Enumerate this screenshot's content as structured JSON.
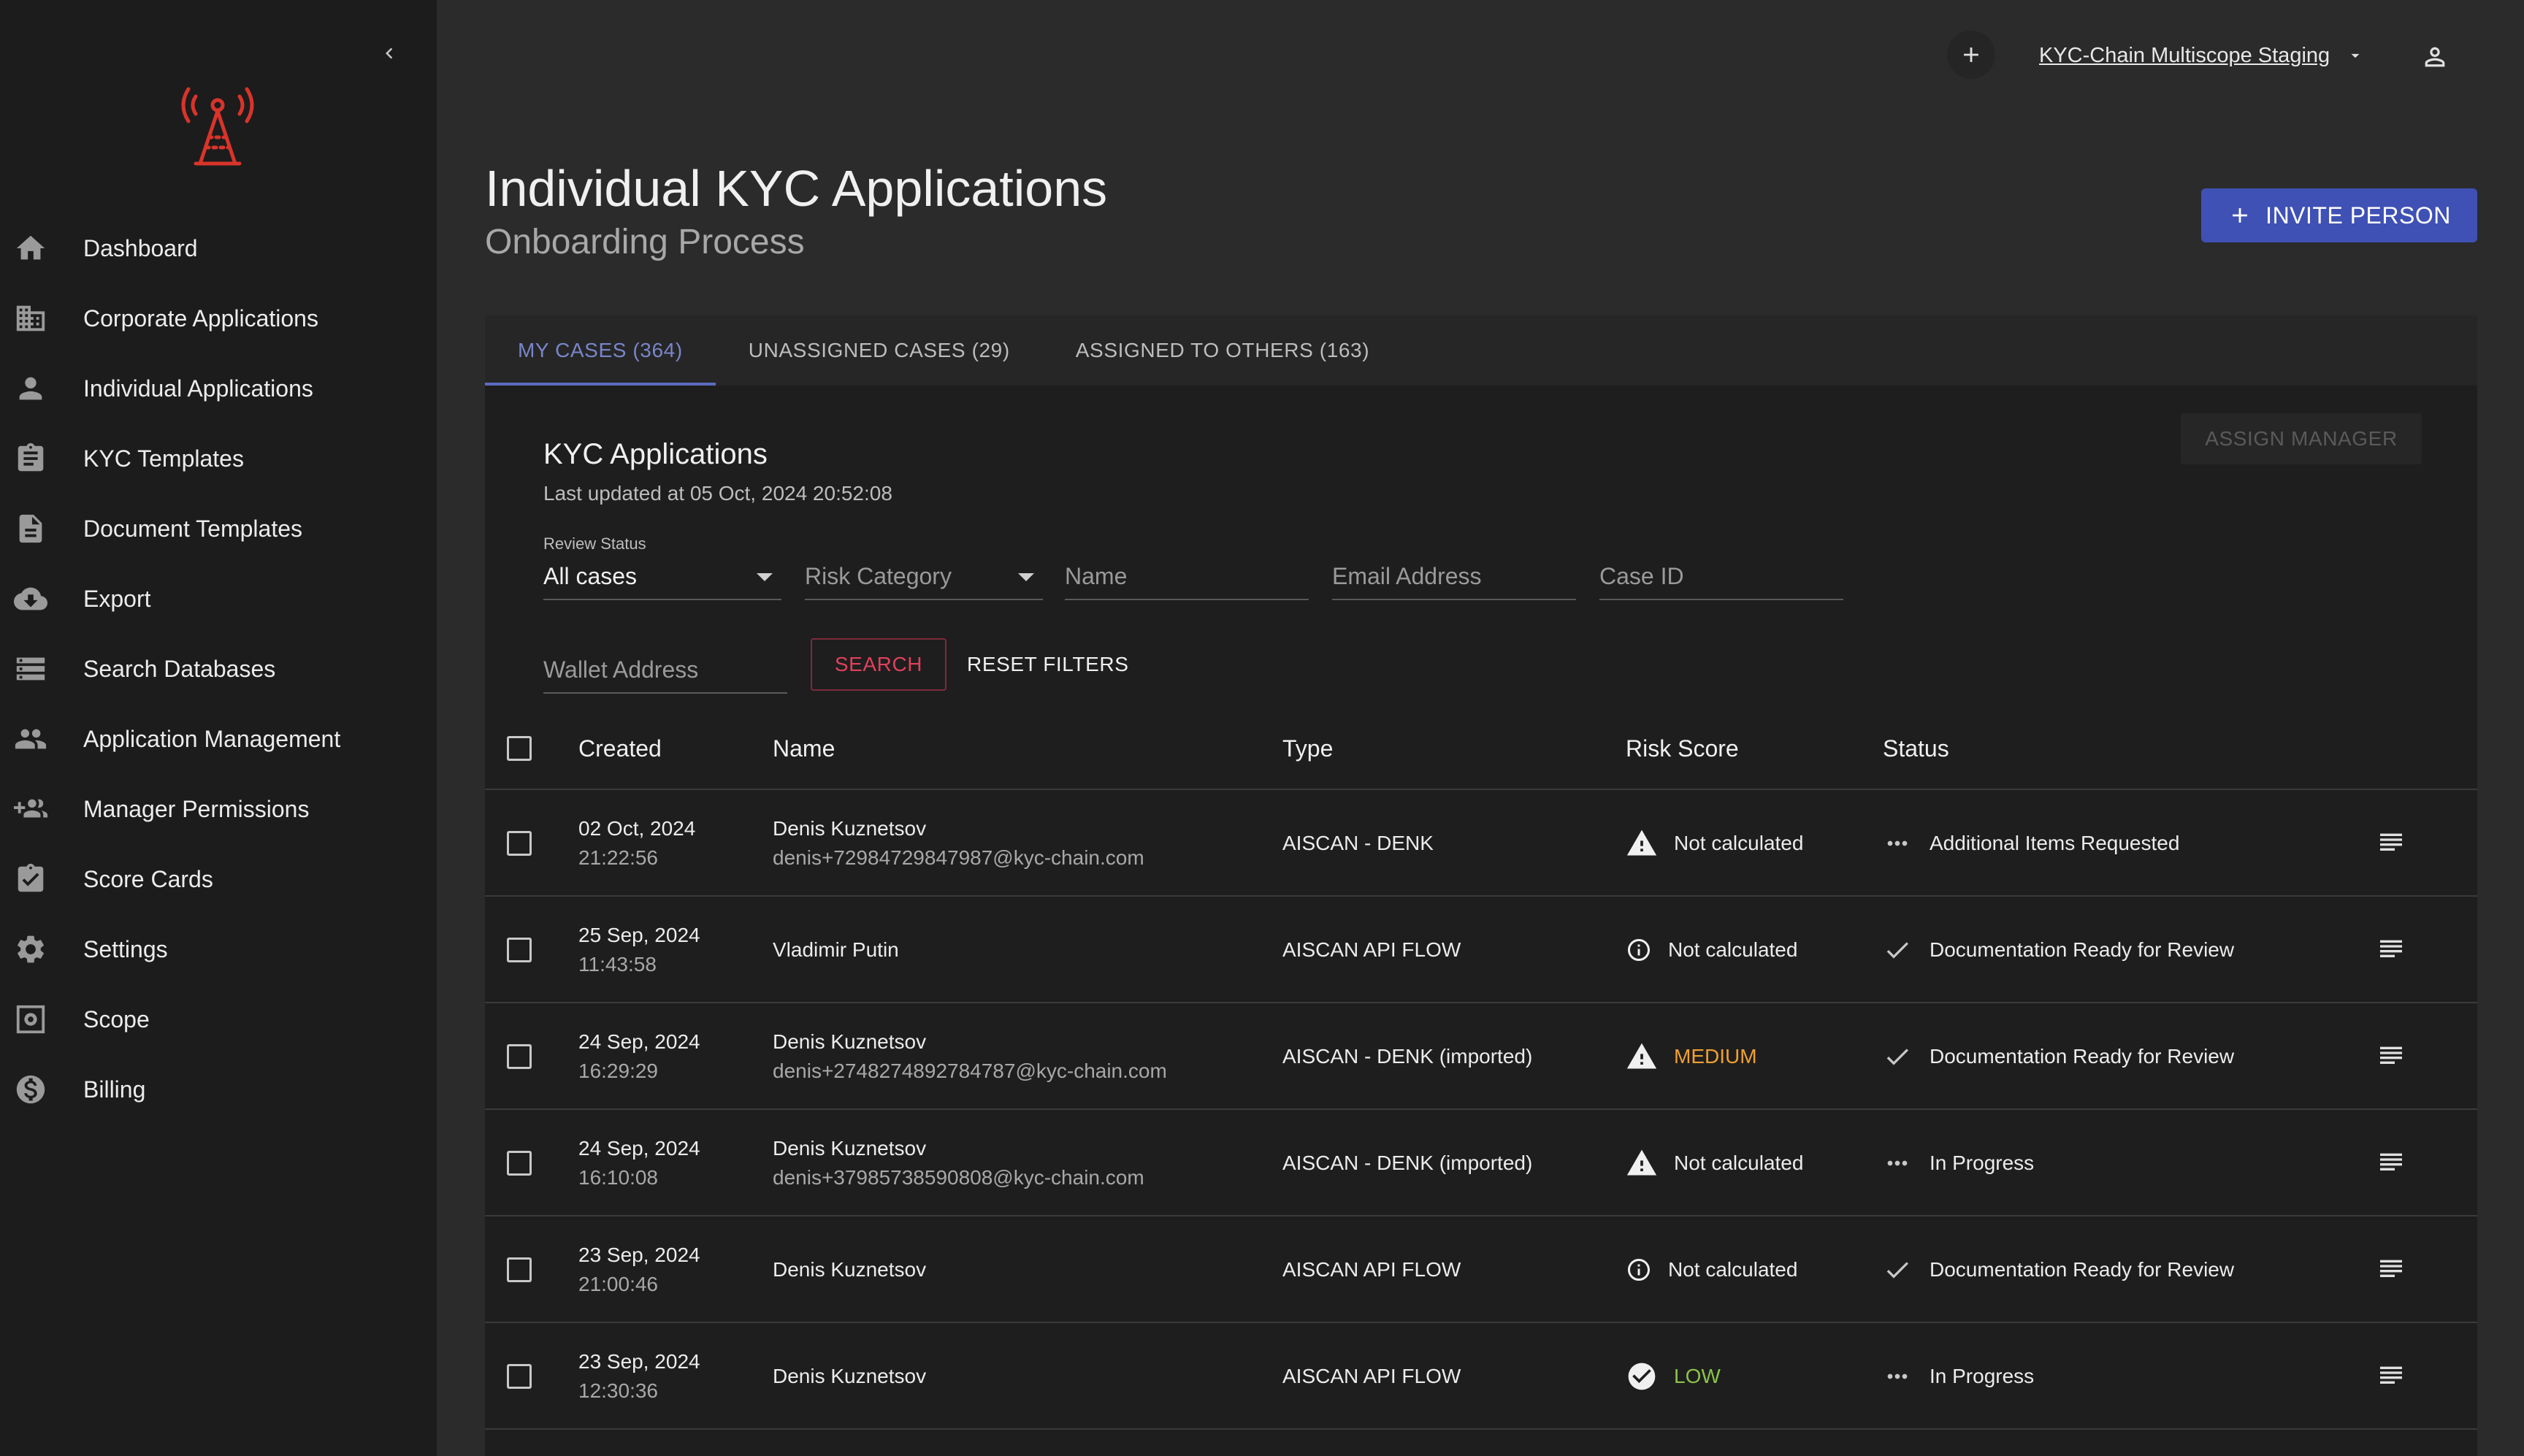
{
  "sidebar": {
    "items": [
      {
        "label": "Dashboard",
        "icon": "home-icon"
      },
      {
        "label": "Corporate Applications",
        "icon": "building-icon"
      },
      {
        "label": "Individual Applications",
        "icon": "person-icon"
      },
      {
        "label": "KYC Templates",
        "icon": "clipboard-icon"
      },
      {
        "label": "Document Templates",
        "icon": "document-icon"
      },
      {
        "label": "Export",
        "icon": "cloud-download-icon"
      },
      {
        "label": "Search Databases",
        "icon": "storage-icon"
      },
      {
        "label": "Application Management",
        "icon": "people-icon"
      },
      {
        "label": "Manager Permissions",
        "icon": "group-add-icon"
      },
      {
        "label": "Score Cards",
        "icon": "assignment-check-icon"
      },
      {
        "label": "Settings",
        "icon": "gear-icon"
      },
      {
        "label": "Scope",
        "icon": "scope-icon"
      },
      {
        "label": "Billing",
        "icon": "dollar-icon"
      }
    ]
  },
  "topbar": {
    "org_name": "KYC-Chain Multiscope Staging"
  },
  "header": {
    "title": "Individual KYC Applications",
    "subtitle": "Onboarding Process",
    "invite_label": "INVITE PERSON"
  },
  "tabs": [
    {
      "label": "MY CASES (364)",
      "active": true
    },
    {
      "label": "UNASSIGNED CASES (29)",
      "active": false
    },
    {
      "label": "ASSIGNED TO OTHERS (163)",
      "active": false
    }
  ],
  "card": {
    "title": "KYC Applications",
    "last_updated": "Last updated at 05 Oct, 2024 20:52:08",
    "assign_label": "ASSIGN MANAGER"
  },
  "filters": {
    "review_status_label": "Review Status",
    "review_status_value": "All cases",
    "risk_category_placeholder": "Risk Category",
    "name_placeholder": "Name",
    "email_placeholder": "Email Address",
    "case_id_placeholder": "Case ID",
    "wallet_placeholder": "Wallet Address",
    "search_label": "SEARCH",
    "reset_label": "RESET FILTERS"
  },
  "table": {
    "headers": {
      "created": "Created",
      "name": "Name",
      "type": "Type",
      "risk": "Risk Score",
      "status": "Status"
    },
    "rows": [
      {
        "date": "02 Oct, 2024",
        "time": "21:22:56",
        "name": "Denis Kuznetsov",
        "email": "denis+72984729847987@kyc-chain.com",
        "type": "AISCAN - DENK",
        "risk": "Not calculated",
        "risk_icon": "warning-icon",
        "risk_color": "#ececec",
        "status": "Additional Items Requested",
        "status_icon": "more-horiz-icon"
      },
      {
        "date": "25 Sep, 2024",
        "time": "11:43:58",
        "name": "Vladimir Putin",
        "email": "",
        "type": "AISCAN API FLOW",
        "risk": "Not calculated",
        "risk_icon": "info-icon",
        "risk_color": "#ececec",
        "status": "Documentation Ready for Review",
        "status_icon": "check-icon"
      },
      {
        "date": "24 Sep, 2024",
        "time": "16:29:29",
        "name": "Denis Kuznetsov",
        "email": "denis+2748274892784787@kyc-chain.com",
        "type": "AISCAN - DENK (imported)",
        "risk": "MEDIUM",
        "risk_icon": "warning-icon",
        "risk_color": "#f0a030",
        "status": "Documentation Ready for Review",
        "status_icon": "check-icon"
      },
      {
        "date": "24 Sep, 2024",
        "time": "16:10:08",
        "name": "Denis Kuznetsov",
        "email": "denis+37985738590808@kyc-chain.com",
        "type": "AISCAN - DENK (imported)",
        "risk": "Not calculated",
        "risk_icon": "warning-icon",
        "risk_color": "#ececec",
        "status": "In Progress",
        "status_icon": "more-horiz-icon"
      },
      {
        "date": "23 Sep, 2024",
        "time": "21:00:46",
        "name": "Denis Kuznetsov",
        "email": "",
        "type": "AISCAN API FLOW",
        "risk": "Not calculated",
        "risk_icon": "info-icon",
        "risk_color": "#ececec",
        "status": "Documentation Ready for Review",
        "status_icon": "check-icon"
      },
      {
        "date": "23 Sep, 2024",
        "time": "12:30:36",
        "name": "Denis Kuznetsov",
        "email": "",
        "type": "AISCAN API FLOW",
        "risk": "LOW",
        "risk_icon": "check-circle-icon",
        "risk_color": "#8bc34a",
        "status": "In Progress",
        "status_icon": "more-horiz-icon"
      }
    ]
  },
  "colors": {
    "brand_red": "#d9342b",
    "accent": "#3f51b5"
  }
}
